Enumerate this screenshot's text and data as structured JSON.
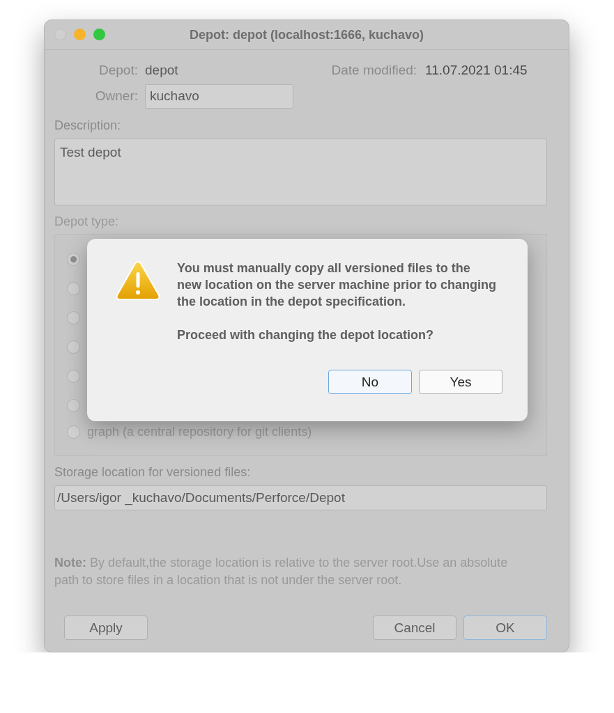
{
  "window": {
    "title": "Depot: depot (localhost:1666,  kuchavo)"
  },
  "form": {
    "depot_label": "Depot:",
    "depot_value": "depot",
    "date_modified_label": "Date modified:",
    "date_modified_value": "11.07.2021 01:45",
    "owner_label": "Owner:",
    "owner_value": "kuchavo",
    "description_label": "Description:",
    "description_value": "Test depot",
    "depot_type_label": "Depot type:",
    "depot_types": [
      {
        "selected": true
      },
      {
        "selected": false
      },
      {
        "selected": false
      },
      {
        "selected": false
      },
      {
        "selected": false
      },
      {
        "selected": false
      },
      {
        "label": "graph (a central repository for git clients)",
        "selected": false
      }
    ],
    "storage_label": "Storage location for versioned files:",
    "storage_value": "/Users/igor _kuchavo/Documents/Perforce/Depot",
    "note": "**Note:** By default,the storage location is relative to the server root.Use an absolute path to store files in a location that is not under the server root."
  },
  "buttons": [
    {
      "label": "Apply",
      "default": false
    },
    {
      "label": "Cancel",
      "default": false
    },
    {
      "label": "OK",
      "default": true
    }
  ],
  "alert": {
    "message": [
      "You must manually copy all versioned files to the new location on the server machine prior to changing the location in the depot specification.",
      "Proceed with changing the depot location?"
    ],
    "buttons": [
      {
        "label": "No",
        "default": true
      },
      {
        "label": "Yes",
        "default": false
      }
    ]
  }
}
